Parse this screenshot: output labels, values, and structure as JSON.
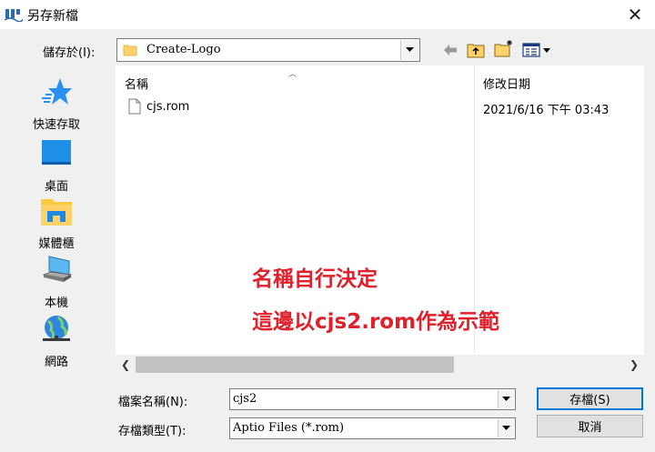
{
  "window": {
    "title": "另存新檔",
    "close_glyph": "✕"
  },
  "toolbar": {
    "savein_label": "儲存於(I):",
    "savein_value": "Create-Logo",
    "back_icon": "back-arrow-icon",
    "up_icon": "up-folder-icon",
    "new_folder_icon": "new-folder-icon",
    "view_menu_icon": "view-menu-icon"
  },
  "places": [
    {
      "label": "快速存取",
      "icon": "star-icon"
    },
    {
      "label": "桌面",
      "icon": "desktop-icon"
    },
    {
      "label": "媒體櫃",
      "icon": "library-icon"
    },
    {
      "label": "本機",
      "icon": "computer-icon"
    },
    {
      "label": "網路",
      "icon": "network-icon"
    }
  ],
  "filelist": {
    "columns": [
      "名稱",
      "修改日期"
    ],
    "rows": [
      {
        "name": "cjs.rom",
        "modified": "2021/6/16 下午 03:43"
      }
    ]
  },
  "annotation": {
    "line1": "名稱自行決定",
    "line2": "這邊以cjs2.rom作為示範"
  },
  "form": {
    "filename_label": "檔案名稱(N):",
    "filename_value": "cjs2",
    "filetype_label": "存檔類型(T):",
    "filetype_value": "Aptio Files (*.rom)",
    "save_button": "存檔(S)",
    "cancel_button": "取消"
  },
  "colors": {
    "accent": "#0078d7",
    "annotation": "#e0202a",
    "folder": "#ffd26a"
  }
}
